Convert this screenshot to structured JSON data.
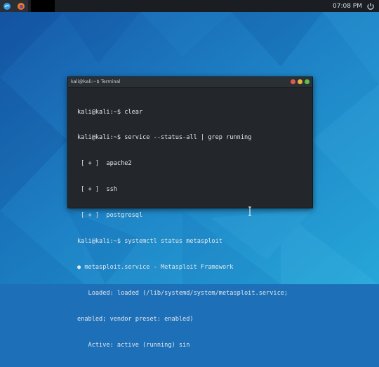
{
  "panel": {
    "clock": "07:08 PM"
  },
  "terminal": {
    "title": "kali@kali:~$ Terminal",
    "lines": [
      "kali@kali:~$ clear",
      "kali@kali:~$ service --status-all | grep running",
      " [ + ]  apache2",
      " [ + ]  ssh",
      " [ + ]  postgresql",
      "kali@kali:~$ systemctl status metasploit",
      "● metasploit.service - Metasploit Framework",
      "   Loaded: loaded (/lib/systemd/system/metasploit.service;",
      "enabled; vendor preset: enabled)",
      "   Active: active (running) sin"
    ]
  },
  "icons": {
    "kali": "kali-menu-icon",
    "firefox": "firefox-icon",
    "power": "power-icon"
  }
}
